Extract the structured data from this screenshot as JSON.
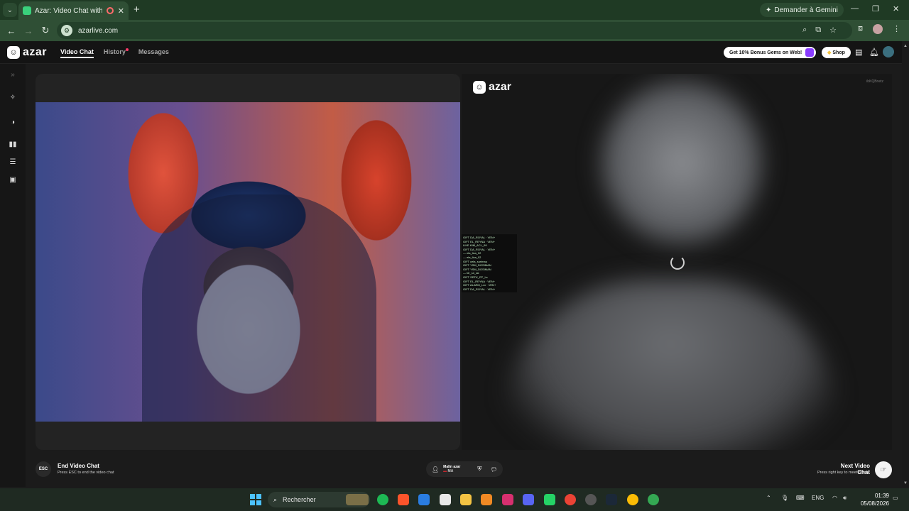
{
  "browser": {
    "tab_title": "Azar: Video Chat with New",
    "tab_close": "✕",
    "new_tab": "+",
    "gemini_label": "Demander à Gemini",
    "url": "azarlive.com",
    "minimize": "—",
    "restore": "❐",
    "close": "✕"
  },
  "app": {
    "logo_text": "azar",
    "nav": {
      "video_chat": "Video Chat",
      "history": "History",
      "messages": "Messages"
    },
    "promo": "Get 10% Bonus Gems on Web!",
    "shop": "Shop",
    "remote_logo": "azar",
    "remote_id": "ibKQBnetz",
    "end_title": "End Video Chat",
    "end_sub": "Press ESC to end the video chat",
    "esc_label": "ESC",
    "partner_name": "Malin azar",
    "partner_country": "MA",
    "next_title": "Next Video Chat",
    "next_sub": "Press right key to meet others"
  },
  "overlay_lines": [
    "GIFT  DA_ROYAL · VEN+",
    "GIFT  EL_REYNA · VEN+",
    "LIKE  KIM_ACL_99",
    "GIFT  DA_ROYAL · VEN+",
    "— ela_liza_02",
    "— ela_liza_02",
    "GIFT  cela_surimau",
    "GIFT  YSM_DOSIMAN",
    "GIFT  YSM_DOSIMAN",
    "— bir_sn_ak",
    "GIFT  SRTK_RT_Ls",
    "GIFT  EL_REYNA · VEN+",
    "GIFT  ALARM_Lxx · VEN+",
    "GIFT  DA_ROYAL · VEN+"
  ],
  "taskbar": {
    "search": "Rechercher",
    "lang": "ENG",
    "time": "01:39",
    "date": "05/08/2026"
  },
  "colors": {
    "chrome_bg": "#1f3a24",
    "accent_green": "#3ad17c",
    "app_bg": "#1b1b1b"
  }
}
